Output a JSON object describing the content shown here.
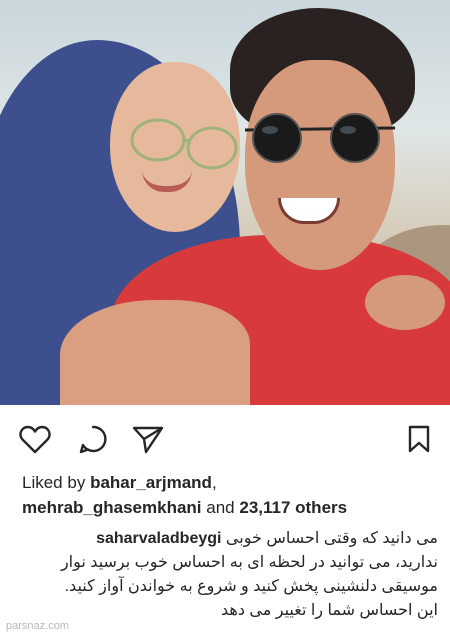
{
  "post": {
    "photo_alt": "selfie-of-two-people",
    "likes": {
      "prefix": "Liked by",
      "user1": "bahar_arjmand",
      "user2": "mehrab_ghasemkhani",
      "connector": "and",
      "count_text": "23,117 others"
    },
    "caption": {
      "username": "saharvaladbeygi",
      "line1": "می دانید که وقتی احساس خوبی",
      "line2": "ندارید، می توانید در لحظه ای به احساس خوب برسید  نوار",
      "line3": "موسیقی دلنشینی پخش کنید و شروع به خواندن آواز کنید.",
      "line4": "این احساس شما را تغییر می دهد"
    },
    "watermark": "parsnaz.com"
  },
  "actions": {
    "like_icon": "heart-icon",
    "comment_icon": "comment-icon",
    "share_icon": "paper-plane-icon",
    "save_icon": "bookmark-icon"
  }
}
